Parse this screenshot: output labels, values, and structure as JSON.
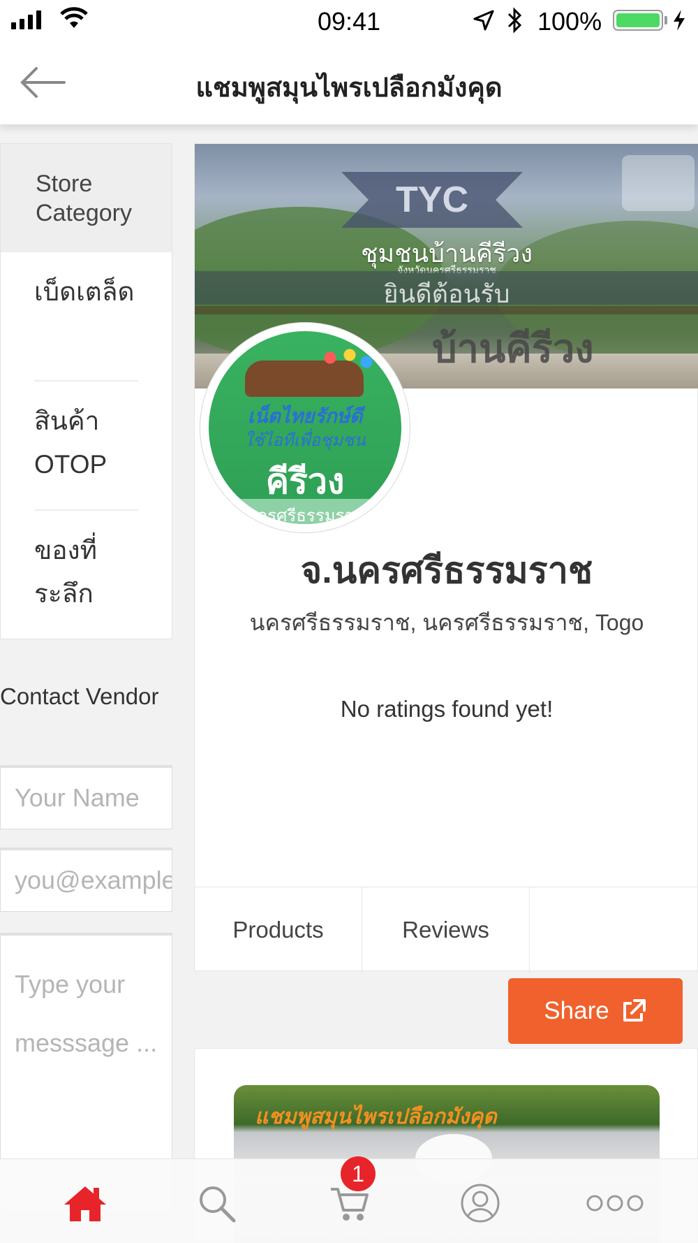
{
  "status_bar": {
    "time": "09:41",
    "battery": "100%",
    "battery_color": "#4cd964",
    "icons": [
      "signal-icon",
      "wifi-icon",
      "location-arrow-icon",
      "bluetooth-icon",
      "battery-icon",
      "charging-bolt-icon"
    ]
  },
  "navbar": {
    "back_icon": "back-arrow-icon",
    "title": "แชมพูสมุนไพรเปลือกมังคุด"
  },
  "sidebar": {
    "category_header": "Store Category",
    "categories": [
      {
        "label": "เบ็ดเตล็ด"
      },
      {
        "label": "สินค้า OTOP"
      },
      {
        "label": "ของที่ระลึก"
      }
    ]
  },
  "contact": {
    "heading": "Contact Vendor",
    "name_placeholder": "Your Name",
    "email_placeholder": "you@example.com",
    "message_placeholder": "Type your messsage ..."
  },
  "banner": {
    "brand": "TYC",
    "community": "ชุมชนบ้านคีรีวง",
    "province_line": "จังหวัดนครศรีธรรมราช",
    "welcome": "ยินดีต้อนรับ",
    "village": "บ้านคีรีวง"
  },
  "logo": {
    "line1": "เน็ตไทยรักษ์ดี",
    "line2": "ใช้ไอทีเพื่อชุมชน",
    "name": "คีรีวง",
    "province": "นครศรีธรรมราช"
  },
  "store": {
    "name": "จ.นครศรีธรรมราช",
    "address": "นครศรีธรรมราช, นครศรีธรรมราช, Togo",
    "rating_text": "No ratings found yet!"
  },
  "tabs": [
    {
      "label": "Products"
    },
    {
      "label": "Reviews"
    },
    {
      "label": ""
    }
  ],
  "share": {
    "label": "Share",
    "icon": "external-link-icon",
    "color": "#f0612d"
  },
  "product_card": {
    "image_title": "แชมพูสมุนไพรเปลือกมังคุด"
  },
  "tabbar": {
    "items": [
      "home-icon",
      "search-icon",
      "cart-icon",
      "account-icon",
      "more-icon"
    ],
    "cart_badge": "1",
    "active_color": "#e8242b"
  }
}
